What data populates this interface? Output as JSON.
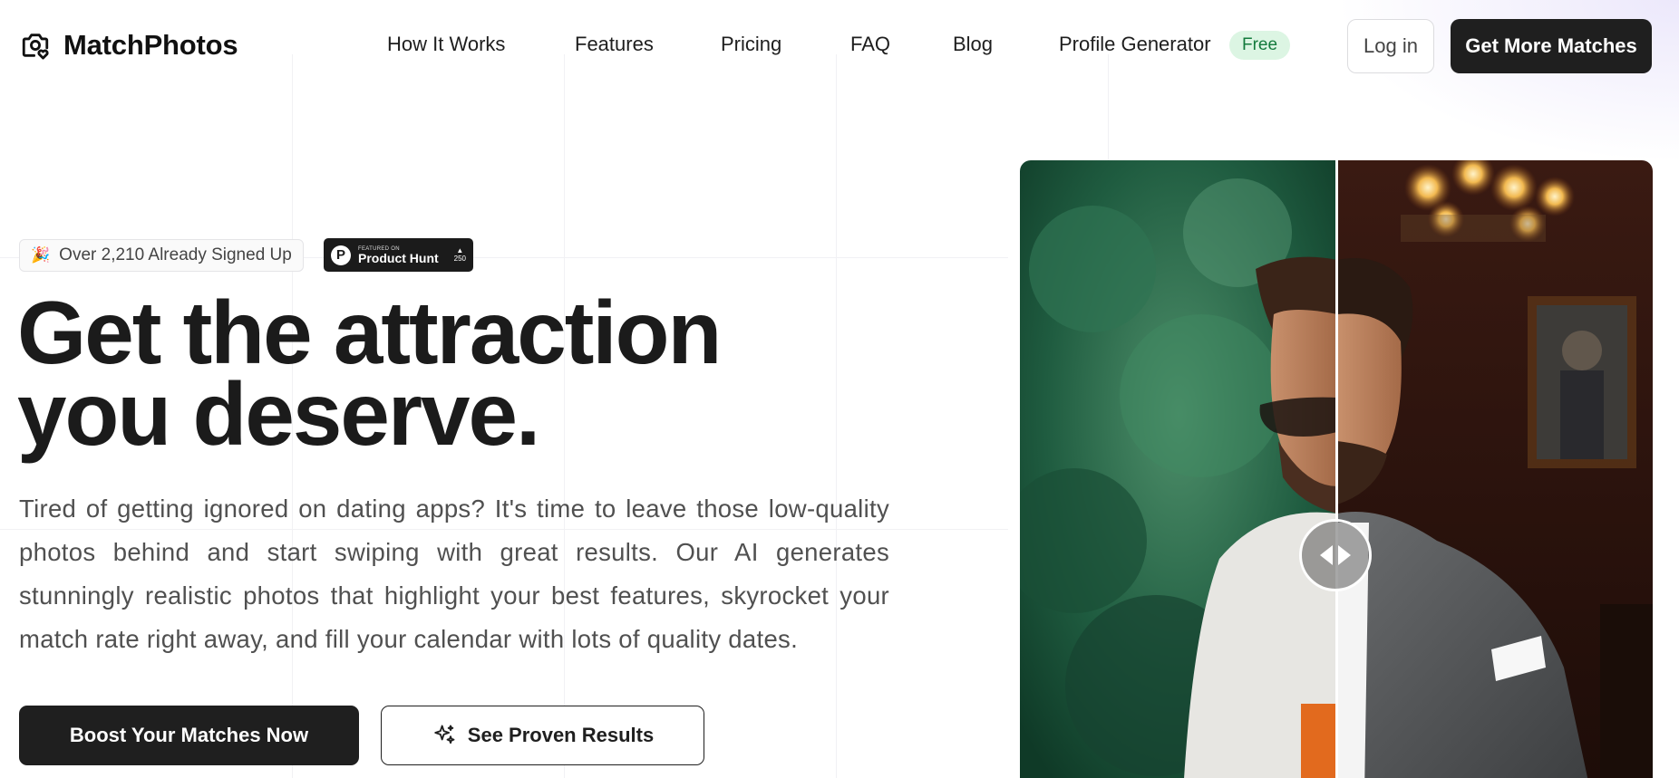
{
  "header": {
    "logo_text": "MatchPhotos",
    "nav": [
      {
        "label": "How It Works"
      },
      {
        "label": "Features"
      },
      {
        "label": "Pricing"
      },
      {
        "label": "FAQ"
      },
      {
        "label": "Blog"
      },
      {
        "label": "Profile Generator"
      }
    ],
    "free_badge": "Free",
    "login_label": "Log in",
    "cta_label": "Get More Matches"
  },
  "badges": {
    "signup_text": "Over 2,210 Already Signed Up",
    "product_hunt": {
      "small": "FEATURED ON",
      "name": "Product Hunt",
      "votes": "250",
      "logo_letter": "P"
    }
  },
  "hero": {
    "headline_line1": "Get the attraction",
    "headline_line2": "you deserve.",
    "subtext": "Tired of getting ignored on dating apps? It's time to leave those low-quality photos behind and start swiping with great results. Our AI generates stunningly realistic photos that highlight your best features, skyrocket your match rate right away, and fill your calendar with lots of quality dates.",
    "primary_button": "Boost Your Matches Now",
    "secondary_button": "See Proven Results"
  },
  "comparison": {
    "split_position_percent": 50
  },
  "colors": {
    "primary": "#1f1f1f",
    "free_badge_bg": "#dcf5e3",
    "free_badge_text": "#137a3c"
  },
  "icons": {
    "logo": "camera-heart-icon",
    "signup": "party-popper-icon",
    "secondary_button": "sparkles-icon",
    "handle": "arrows-left-right-icon"
  }
}
